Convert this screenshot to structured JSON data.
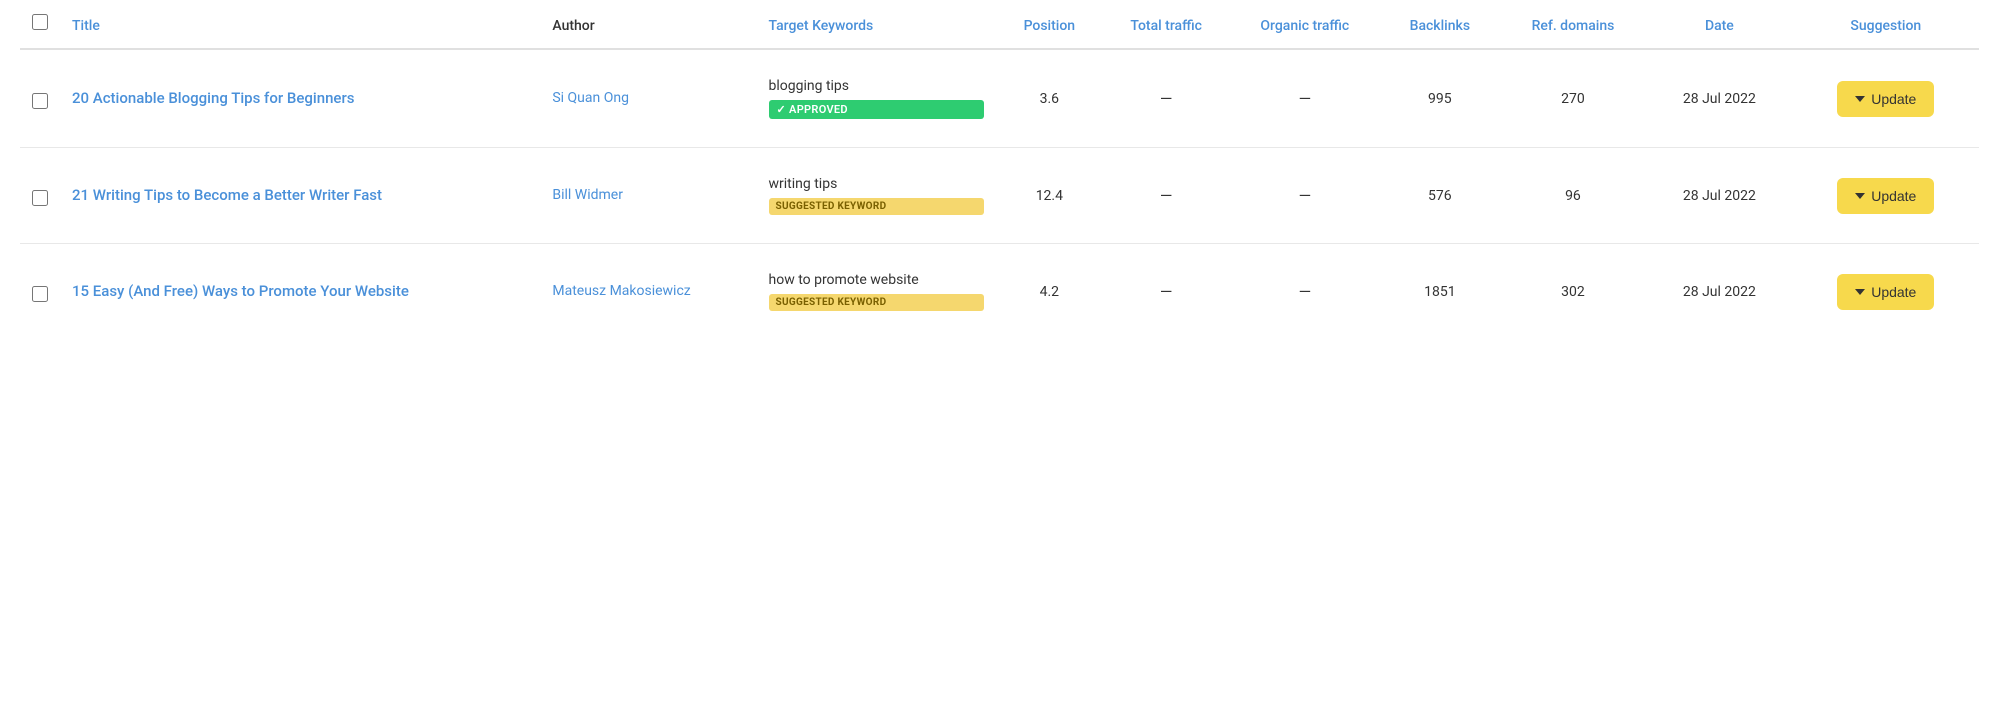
{
  "colors": {
    "accent": "#4a90d9",
    "badge_approved_bg": "#2ecc71",
    "badge_suggested_bg": "#f5d76e",
    "update_btn_bg": "#f7d94c"
  },
  "table": {
    "headers": {
      "checkbox": "",
      "title": "Title",
      "author": "Author",
      "target_keywords": "Target Keywords",
      "position": "Position",
      "total_traffic": "Total traffic",
      "organic_traffic": "Organic traffic",
      "backlinks": "Backlinks",
      "ref_domains": "Ref. domains",
      "date": "Date",
      "suggestion": "Suggestion"
    },
    "rows": [
      {
        "id": "row-1",
        "title": "20 Actionable Blogging Tips for Beginners",
        "author": "Si Quan Ong",
        "keyword": "blogging tips",
        "keyword_badge_type": "approved",
        "keyword_badge_label": "✓ APPROVED",
        "position": "3.6",
        "total_traffic": "—",
        "organic_traffic": "—",
        "backlinks": "995",
        "ref_domains": "270",
        "date": "28 Jul 2022",
        "suggestion_label": "Update"
      },
      {
        "id": "row-2",
        "title": "21 Writing Tips to Become a Better Writer Fast",
        "author": "Bill Widmer",
        "keyword": "writing tips",
        "keyword_badge_type": "suggested",
        "keyword_badge_label": "SUGGESTED KEYWORD",
        "position": "12.4",
        "total_traffic": "—",
        "organic_traffic": "—",
        "backlinks": "576",
        "ref_domains": "96",
        "date": "28 Jul 2022",
        "suggestion_label": "Update"
      },
      {
        "id": "row-3",
        "title": "15 Easy (And Free) Ways to Promote Your Website",
        "author": "Mateusz Makosiewicz",
        "keyword": "how to promote website",
        "keyword_badge_type": "suggested",
        "keyword_badge_label": "SUGGESTED KEYWORD",
        "position": "4.2",
        "total_traffic": "—",
        "organic_traffic": "—",
        "backlinks": "1851",
        "ref_domains": "302",
        "date": "28 Jul 2022",
        "suggestion_label": "Update"
      }
    ]
  }
}
